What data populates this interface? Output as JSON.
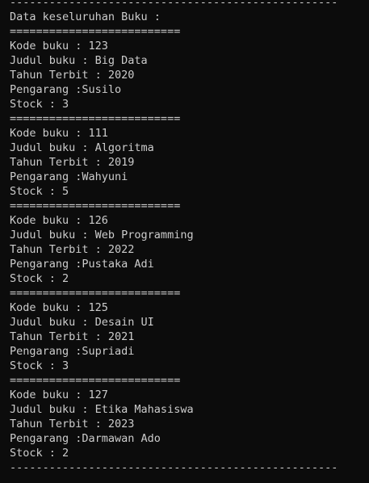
{
  "console": {
    "top_rule": "--------------------------------------------------",
    "header": "Data keseluruhan Buku :",
    "separator": "==========================",
    "bottom_rule": "--------------------------------------------------",
    "books": [
      {
        "kode": "Kode buku : 123",
        "judul": "Judul buku : Big Data",
        "tahun": "Tahun Terbit : 2020",
        "pengarang": "Pengarang :Susilo",
        "stock": "Stock : 3"
      },
      {
        "kode": "Kode buku : 111",
        "judul": "Judul buku : Algoritma",
        "tahun": "Tahun Terbit : 2019",
        "pengarang": "Pengarang :Wahyuni",
        "stock": "Stock : 5"
      },
      {
        "kode": "Kode buku : 126",
        "judul": "Judul buku : Web Programming",
        "tahun": "Tahun Terbit : 2022",
        "pengarang": "Pengarang :Pustaka Adi",
        "stock": "Stock : 2"
      },
      {
        "kode": "Kode buku : 125",
        "judul": "Judul buku : Desain UI",
        "tahun": "Tahun Terbit : 2021",
        "pengarang": "Pengarang :Supriadi",
        "stock": "Stock : 3"
      },
      {
        "kode": "Kode buku : 127",
        "judul": "Judul buku : Etika Mahasiswa",
        "tahun": "Tahun Terbit : 2023",
        "pengarang": "Pengarang :Darmawan Ado",
        "stock": "Stock : 2"
      }
    ]
  },
  "colors": {
    "background": "#0c0c0c",
    "text": "#cccccc"
  }
}
